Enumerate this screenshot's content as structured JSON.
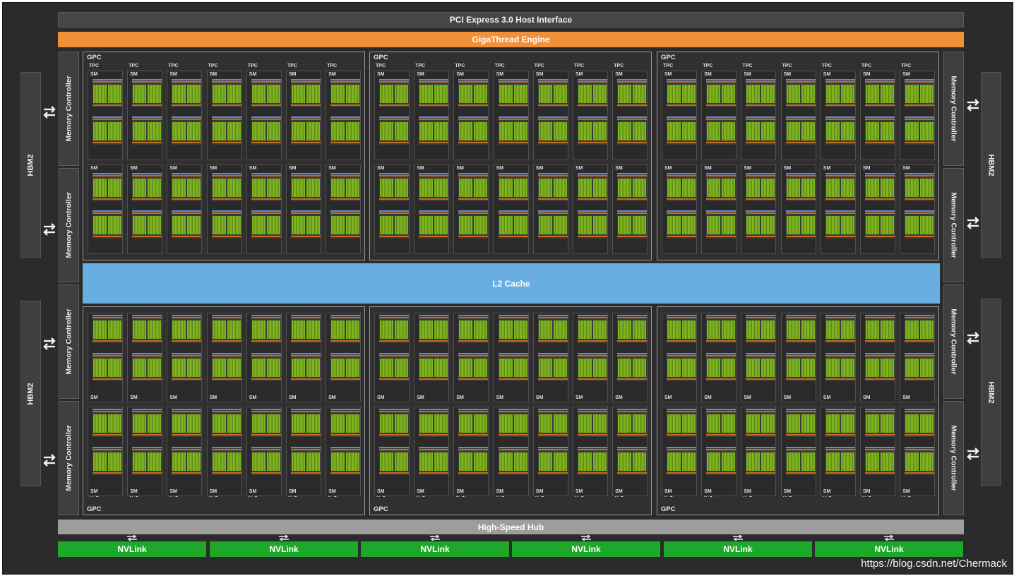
{
  "pci_interface": "PCI Express 3.0 Host Interface",
  "giga_thread": "GigaThread Engine",
  "l2_cache": "L2 Cache",
  "high_speed_hub": "High-Speed Hub",
  "hbm_label": "HBM2",
  "memory_controller_label": "Memory Controller",
  "gpc_label": "GPC",
  "tpc_label": "TPC",
  "sm_label": "SM",
  "nvlink_label": "NVLink",
  "nvlinks": [
    "NVLink",
    "NVLink",
    "NVLink",
    "NVLink",
    "NVLink",
    "NVLink"
  ],
  "watermark": "https://blog.csdn.net/Chermack",
  "colors": {
    "giga_thread": "#f0913a",
    "l2_cache": "#69aee0",
    "nvlink": "#1ea82a",
    "hub": "#9d9d9d",
    "core_green": "#7fb321",
    "core_orange": "#c96a1f",
    "core_blue": "#5b8fd0"
  }
}
